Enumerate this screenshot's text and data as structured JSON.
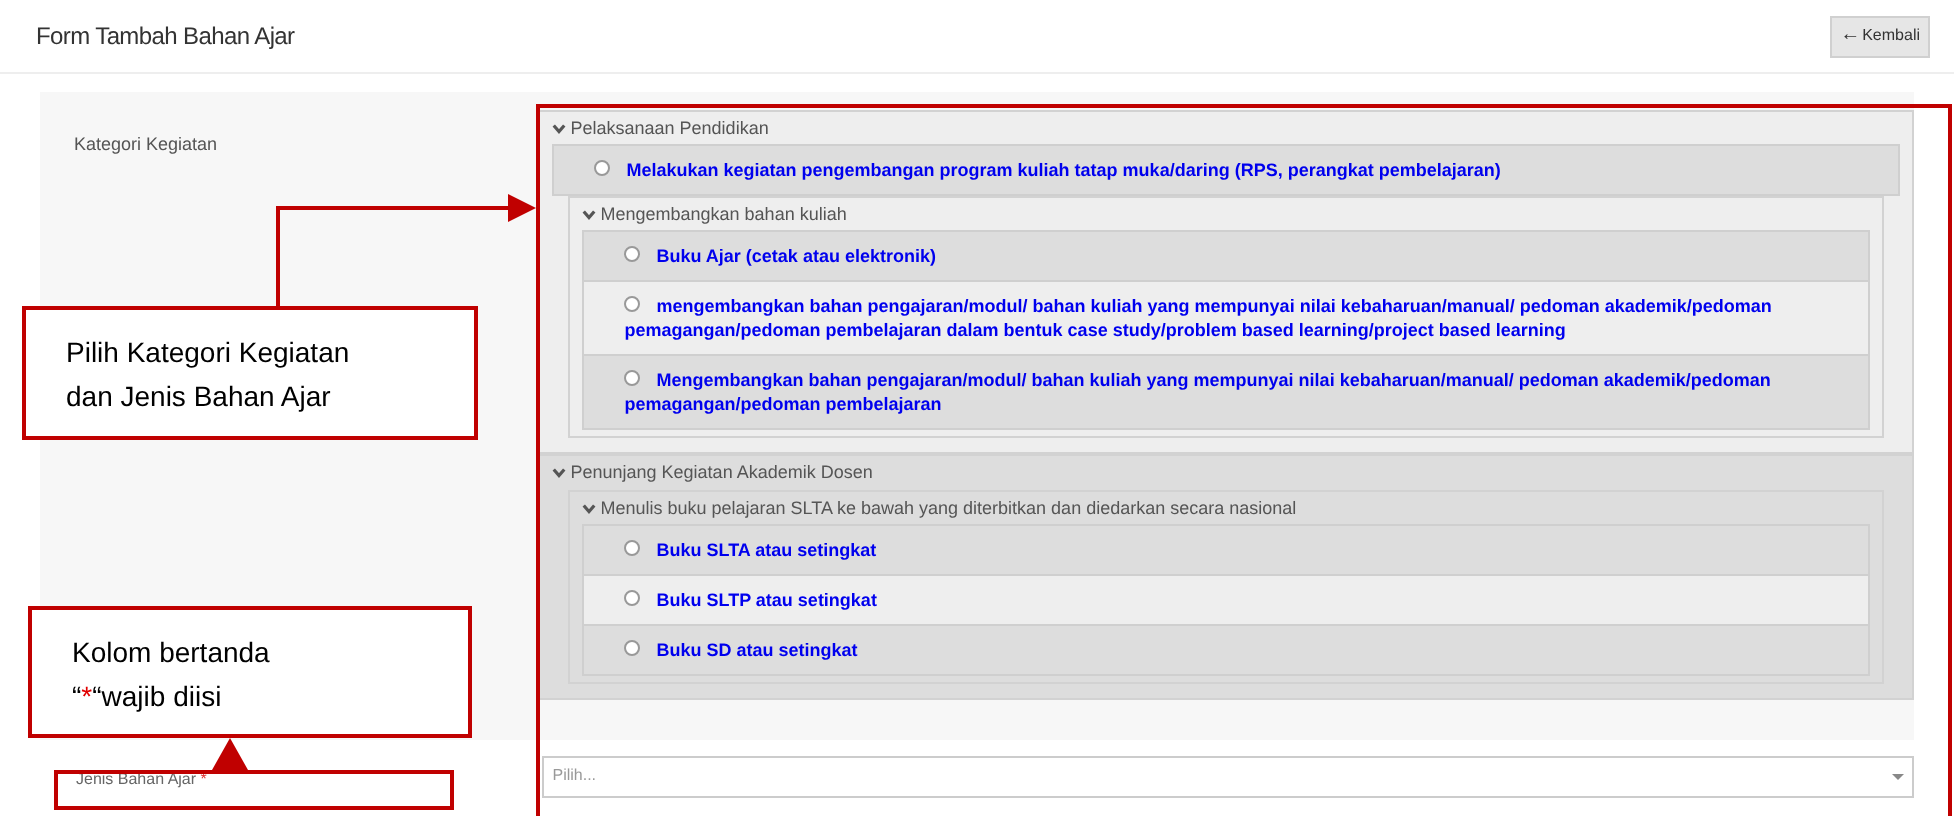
{
  "page_title": "Form Tambah Bahan Ajar",
  "back_button": {
    "icon": "←",
    "label": "Kembali"
  },
  "category_field": {
    "label": "Kategori Kegiatan",
    "tree": [
      {
        "kind": "group",
        "label": "Pelaksanaan Pendidikan",
        "expanded": true,
        "children": [
          {
            "kind": "option",
            "label": "Melakukan kegiatan pengembangan program kuliah tatap muka/daring (RPS, perangkat pembelajaran)",
            "selected": false
          },
          {
            "kind": "group",
            "label": "Mengembangkan bahan kuliah",
            "expanded": true,
            "children": [
              {
                "kind": "option",
                "label": "Buku Ajar (cetak atau elektronik)",
                "selected": false
              },
              {
                "kind": "option",
                "label": "mengembangkan bahan pengajaran/modul/ bahan kuliah yang mempunyai nilai kebaharuan/manual/ pedoman akademik/pedoman pemagangan/pedoman pembelajaran dalam bentuk case study/problem based learning/project based learning",
                "selected": false
              },
              {
                "kind": "option",
                "label": "Mengembangkan bahan pengajaran/modul/ bahan kuliah yang mempunyai nilai kebaharuan/manual/ pedoman akademik/pedoman pemagangan/pedoman pembelajaran",
                "selected": false
              }
            ]
          }
        ]
      },
      {
        "kind": "group",
        "label": "Penunjang Kegiatan Akademik Dosen",
        "expanded": true,
        "children": [
          {
            "kind": "group",
            "label": "Menulis buku pelajaran SLTA ke bawah yang diterbitkan dan diedarkan secara nasional",
            "expanded": true,
            "children": [
              {
                "kind": "option",
                "label": "Buku SLTA atau setingkat",
                "selected": false
              },
              {
                "kind": "option",
                "label": "Buku SLTP atau setingkat",
                "selected": false
              },
              {
                "kind": "option",
                "label": "Buku SD atau setingkat",
                "selected": false
              }
            ]
          }
        ]
      }
    ]
  },
  "type_field": {
    "label": "Jenis Bahan Ajar",
    "required_mark": "*",
    "placeholder": "Pilih..."
  },
  "annotations": [
    {
      "text": "Pilih Kategori Kegiatan dan Jenis Bahan Ajar"
    },
    {
      "text_before": "Kolom bertanda\n“",
      "mark": "*",
      "text_after": "“wajib diisi"
    }
  ]
}
